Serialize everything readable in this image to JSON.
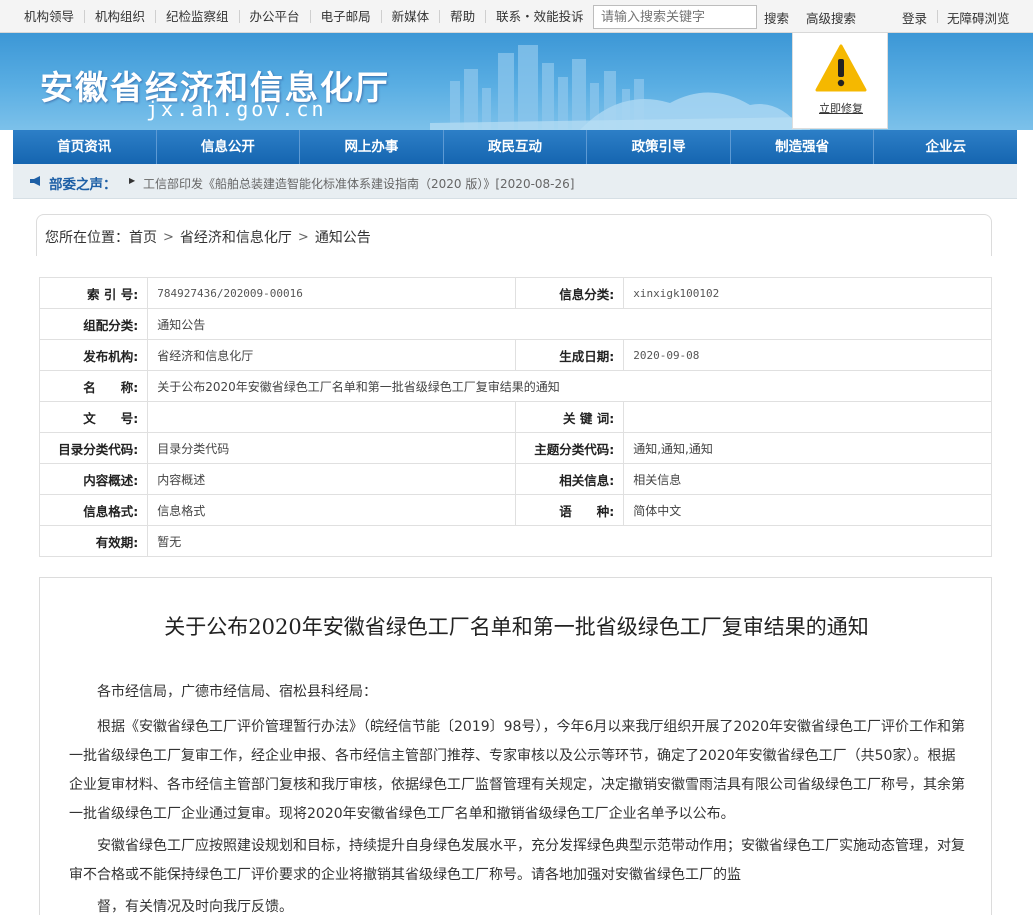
{
  "topbar": {
    "links": [
      "机构领导",
      "机构组织",
      "纪检监察组",
      "办公平台",
      "电子邮局",
      "新媒体",
      "帮助",
      "联系・效能投诉"
    ],
    "search_placeholder": "请输入搜索关键字",
    "search_label": "搜索",
    "advanced_search_label": "高级搜索",
    "login_label": "登录",
    "accessibility_label": "无障碍浏览"
  },
  "banner": {
    "title": "安徽省经济和信息化厅",
    "domain": "jx.ah.gov.cn",
    "warning_link": "立即修复"
  },
  "nav": [
    "首页资讯",
    "信息公开",
    "网上办事",
    "政民互动",
    "政策引导",
    "制造强省",
    "企业云"
  ],
  "voice": {
    "label": "部委之声：",
    "news": "工信部印发《船舶总装建造智能化标准体系建设指南（2020 版）》[2020-08-26]"
  },
  "breadcrumb": {
    "prefix": "您所在位置：",
    "items": [
      "首页",
      "省经济和信息化厅",
      "通知公告"
    ]
  },
  "info_table": [
    {
      "l1": "索 引 号:",
      "v1": "784927436/202009-00016",
      "l2": "信息分类:",
      "v2": "xinxigk100102"
    },
    {
      "l1": "组配分类:",
      "v1": "通知公告"
    },
    {
      "l1": "发布机构:",
      "v1": "省经济和信息化厅",
      "l2": "生成日期:",
      "v2": "2020-09-08"
    },
    {
      "l1": "名　　称:",
      "v1": "关于公布2020年安徽省绿色工厂名单和第一批省级绿色工厂复审结果的通知"
    },
    {
      "l1": "文　　号:",
      "v1": "",
      "l2": "关 键 词:",
      "v2": ""
    },
    {
      "l1": "目录分类代码:",
      "v1": "目录分类代码",
      "l2": "主题分类代码:",
      "v2": "通知,通知,通知"
    },
    {
      "l1": "内容概述:",
      "v1": "内容概述",
      "l2": "相关信息:",
      "v2": "相关信息"
    },
    {
      "l1": "信息格式:",
      "v1": "信息格式",
      "l2": "语　　种:",
      "v2": "简体中文"
    },
    {
      "l1": "有效期:",
      "v1": "暂无"
    }
  ],
  "article": {
    "title": "关于公布2020年安徽省绿色工厂名单和第一批省级绿色工厂复审结果的通知",
    "salutation": "各市经信局，广德市经信局、宿松县科经局：",
    "paragraphs": [
      "根据《安徽省绿色工厂评价管理暂行办法》（皖经信节能〔2019〕98号），今年6月以来我厅组织开展了2020年安徽省绿色工厂评价工作和第一批省级绿色工厂复审工作，经企业申报、各市经信主管部门推荐、专家审核以及公示等环节，确定了2020年安徽省绿色工厂（共50家）。根据企业复审材料、各市经信主管部门复核和我厅审核，依据绿色工厂监督管理有关规定，决定撤销安徽雪雨洁具有限公司省级绿色工厂称号，其余第一批省级绿色工厂企业通过复审。现将2020年安徽省绿色工厂名单和撤销省级绿色工厂企业名单予以公布。",
      "安徽省绿色工厂应按照建设规划和目标，持续提升自身绿色发展水平，充分发挥绿色典型示范带动作用；安徽省绿色工厂实施动态管理，对复审不合格或不能保持绿色工厂评价要求的企业将撤销其省级绿色工厂称号。请各地加强对安徽省绿色工厂的监",
      "督，有关情况及时向我厅反馈。"
    ]
  },
  "colors": {
    "nav_blue": "#1565b0",
    "banner_blue": "#3c97d6",
    "voice_label": "#1d5fa6",
    "warning_yellow": "#f5b800"
  }
}
